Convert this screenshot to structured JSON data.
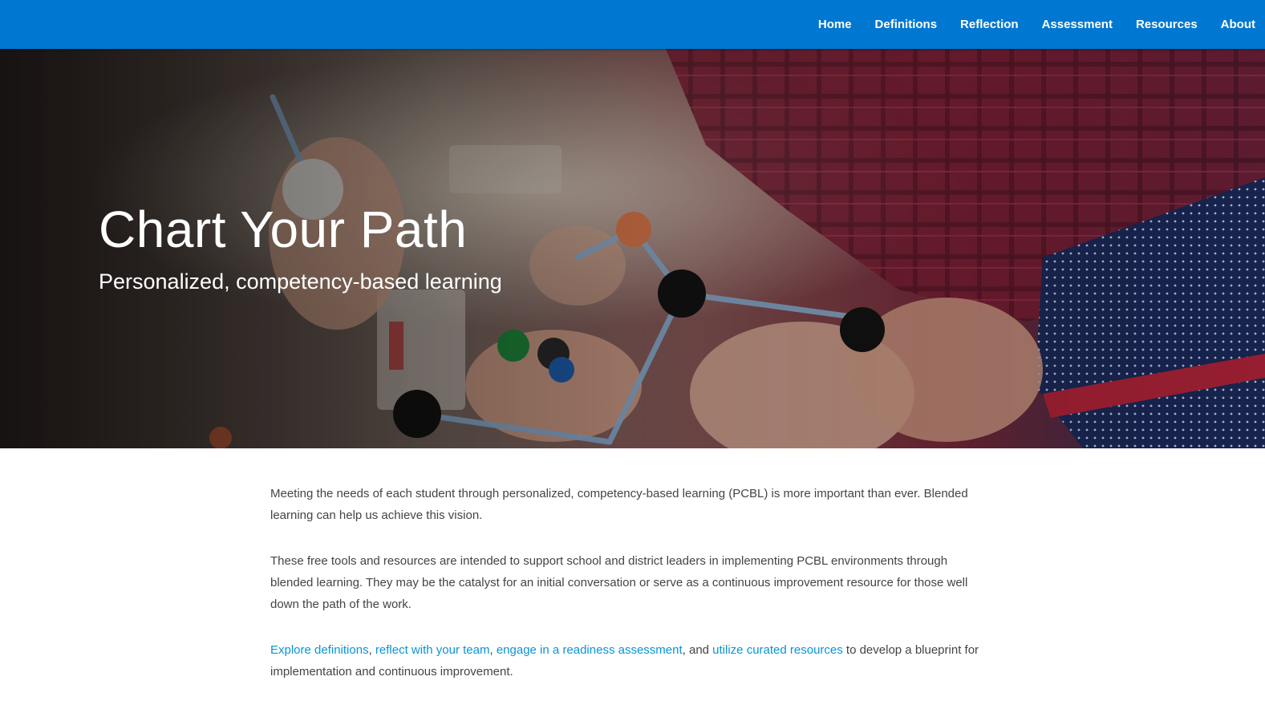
{
  "nav": {
    "items": [
      {
        "label": "Home"
      },
      {
        "label": "Definitions"
      },
      {
        "label": "Reflection"
      },
      {
        "label": "Assessment"
      },
      {
        "label": "Resources"
      },
      {
        "label": "About"
      }
    ]
  },
  "hero": {
    "title": "Chart Your Path",
    "subtitle": "Personalized, competency-based learning"
  },
  "content": {
    "paragraph1": "Meeting the needs of each student through personalized, competency-based learning (PCBL) is more important than ever. Blended learning can help us achieve this vision.",
    "paragraph2": "These free tools and resources are intended to support school and district leaders in implementing PCBL environments through blended learning. They may be the catalyst for an initial conversation or serve as a continuous improvement resource for those well down the path of the work.",
    "paragraph3": {
      "link1": "Explore definitions",
      "sep1": ", ",
      "link2": "reflect with your team",
      "sep2": ", ",
      "link3": "engage in a readiness assessment",
      "sep3": ", and ",
      "link4": "utilize curated resources",
      "tail": " to develop a blueprint for implementation and continuous improvement."
    }
  },
  "colors": {
    "nav_bg": "#0077d0",
    "link": "#0a94d6",
    "body_text": "#444444"
  }
}
